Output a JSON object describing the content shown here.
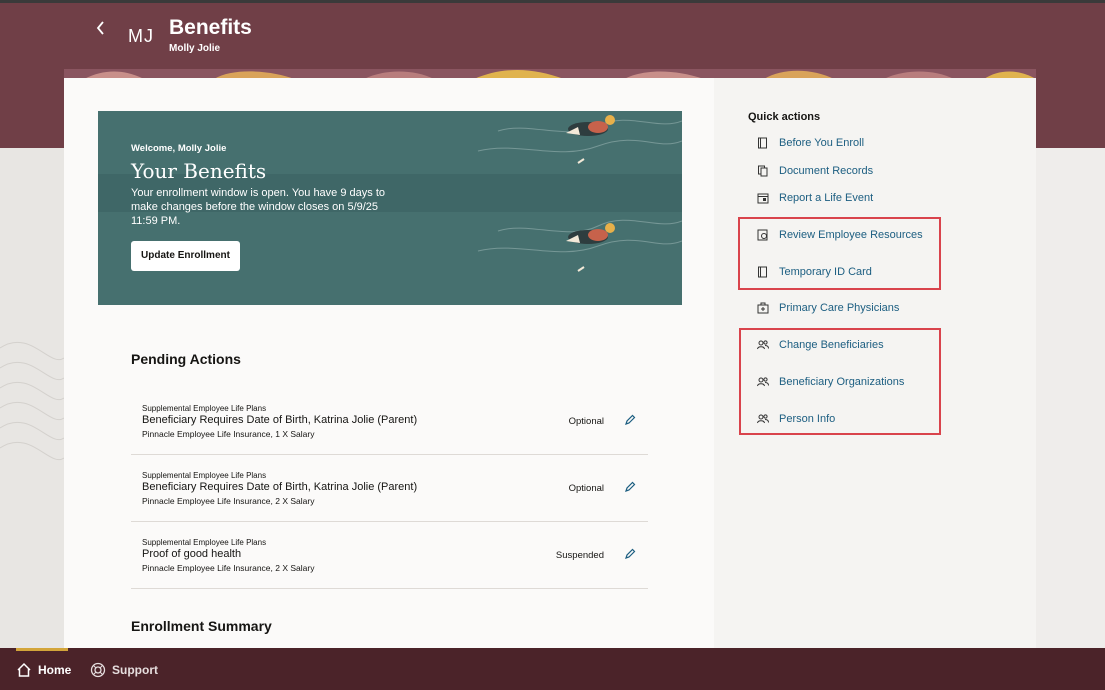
{
  "header": {
    "back_icon": "chevron-left-icon",
    "initials": "MJ",
    "title": "Benefits",
    "subtitle": "Molly Jolie",
    "bg_color": "#703f47"
  },
  "hero": {
    "welcome": "Welcome, Molly Jolie",
    "title": "Your Benefits",
    "text": "Your enrollment window is open. You have 9 days to make changes before the window closes on 5/9/25 11:59 PM.",
    "button": "Update Enrollment",
    "bg_color": "#46706f"
  },
  "pending": {
    "title": "Pending Actions",
    "items": [
      {
        "category": "Supplemental Employee Life Plans",
        "title": "Beneficiary Requires Date of Birth, Katrina Jolie (Parent)",
        "subtitle": "Pinnacle Employee Life Insurance, 1 X Salary",
        "status": "Optional"
      },
      {
        "category": "Supplemental Employee Life Plans",
        "title": "Beneficiary Requires Date of Birth, Katrina Jolie (Parent)",
        "subtitle": "Pinnacle Employee Life Insurance, 2 X Salary",
        "status": "Optional"
      },
      {
        "category": "Supplemental Employee Life Plans",
        "title": "Proof of good health",
        "subtitle": "Pinnacle Employee Life Insurance, 2 X Salary",
        "status": "Suspended"
      }
    ]
  },
  "enrollment_summary": {
    "title": "Enrollment Summary"
  },
  "quick_actions": {
    "title": "Quick actions",
    "items": [
      {
        "label": "Before You Enroll",
        "icon": "book-icon"
      },
      {
        "label": "Document Records",
        "icon": "documents-icon"
      },
      {
        "label": "Report a Life Event",
        "icon": "calendar-event-icon"
      },
      {
        "label": "Review Employee Resources",
        "icon": "resources-icon"
      },
      {
        "label": "Temporary ID Card",
        "icon": "id-card-icon"
      },
      {
        "label": "Primary Care Physicians",
        "icon": "medical-kit-icon"
      },
      {
        "label": "Change Beneficiaries",
        "icon": "people-icon"
      },
      {
        "label": "Beneficiary Organizations",
        "icon": "people-icon"
      },
      {
        "label": "Person Info",
        "icon": "people-icon"
      }
    ],
    "link_color": "#1c5e81",
    "highlight_color": "#d9434c"
  },
  "footer": {
    "home": "Home",
    "support": "Support",
    "home_icon": "home-icon",
    "support_icon": "lifebuoy-icon"
  }
}
